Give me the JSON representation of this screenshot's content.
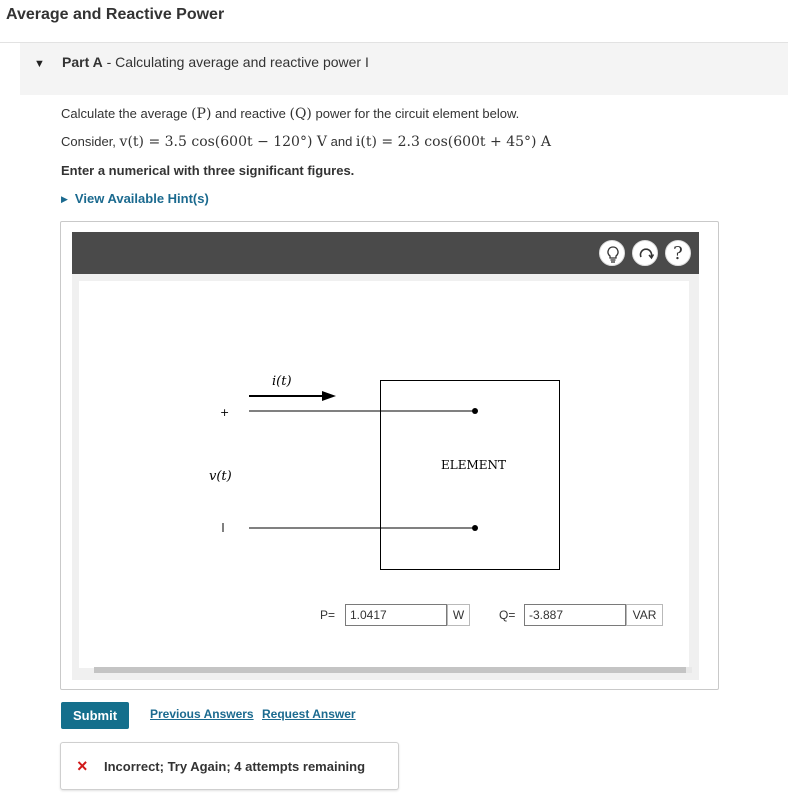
{
  "page": {
    "title": "Average and Reactive Power"
  },
  "part": {
    "label": "Part A",
    "separator": " - ",
    "name": "Calculating average and reactive power I"
  },
  "prompt": {
    "line1_pre": "Calculate the average ",
    "avg_symbol": "(P)",
    "line1_mid": " and reactive ",
    "reactive_symbol": "(Q)",
    "line1_post": " power for the circuit element below.",
    "consider": "Consider, ",
    "voltage_expr": "v(t) = 3.5 cos(600t − 120°) V",
    "and": " and ",
    "current_expr": "i(t) = 2.3 cos(600t + 45°) A",
    "instruction": "Enter a numerical with three significant figures."
  },
  "hints": {
    "label": "View Available Hint(s)"
  },
  "toolbar": {
    "hint_icon": "lightbulb-icon",
    "reset_icon": "reset-icon",
    "help_icon": "help-icon",
    "help_glyph": "?"
  },
  "circuit": {
    "current_label": "i(t)",
    "voltage_label": "v(t)",
    "plus": "+",
    "minus": "−",
    "element_label": "ELEMENT"
  },
  "answers": {
    "p_label": "P=",
    "p_value": "1.0417",
    "p_unit": "W",
    "q_label": "Q=",
    "q_value": "-3.887",
    "q_unit": "VAR"
  },
  "actions": {
    "submit": "Submit",
    "previous_answers": "Previous Answers",
    "request_answer": "Request Answer"
  },
  "feedback": {
    "icon": "×",
    "message": "Incorrect; Try Again; 4 attempts remaining"
  },
  "colors": {
    "accent": "#146f8c",
    "link": "#1b6a8f",
    "error": "#d11a1a",
    "toolbar": "#4a4a4a"
  }
}
